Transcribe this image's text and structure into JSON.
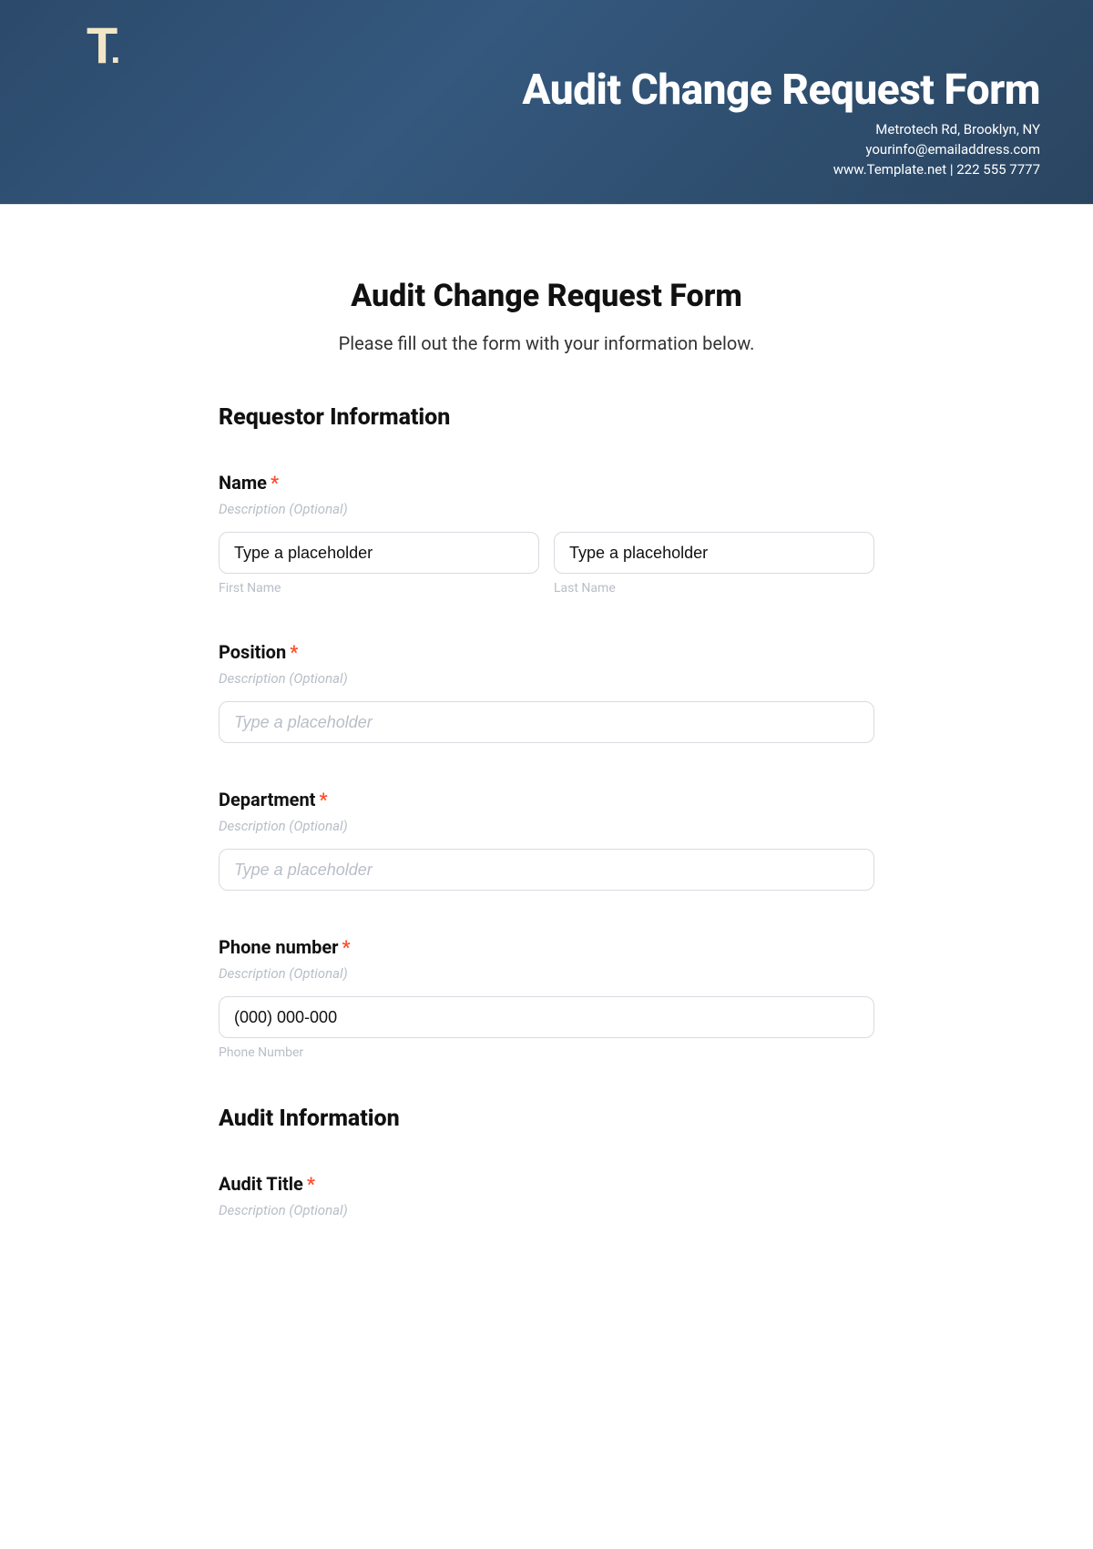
{
  "hero": {
    "title": "Audit Change Request Form",
    "meta_line1": "Metrotech Rd, Brooklyn, NY",
    "meta_line2": "yourinfo@emailaddress.com",
    "meta_line3": "www.Template.net  |  222 555 7777",
    "logo_text": "T",
    "logo_dot": "."
  },
  "form": {
    "title": "Audit Change Request Form",
    "subtitle": "Please fill out the form with your information below.",
    "desc_optional": "Description (Optional)",
    "placeholder_generic": "Type a placeholder",
    "required_mark": "*",
    "sections": {
      "requestor": {
        "heading": "Requestor Information",
        "fields": {
          "name": {
            "label": "Name",
            "first_value": "Type a placeholder",
            "last_value": "Type a placeholder",
            "first_caption": "First Name",
            "last_caption": "Last Name"
          },
          "position": {
            "label": "Position"
          },
          "department": {
            "label": "Department"
          },
          "phone": {
            "label": "Phone number",
            "value": "(000) 000-000",
            "caption": "Phone Number"
          }
        }
      },
      "audit": {
        "heading": "Audit Information",
        "fields": {
          "title": {
            "label": "Audit Title"
          }
        }
      }
    }
  }
}
